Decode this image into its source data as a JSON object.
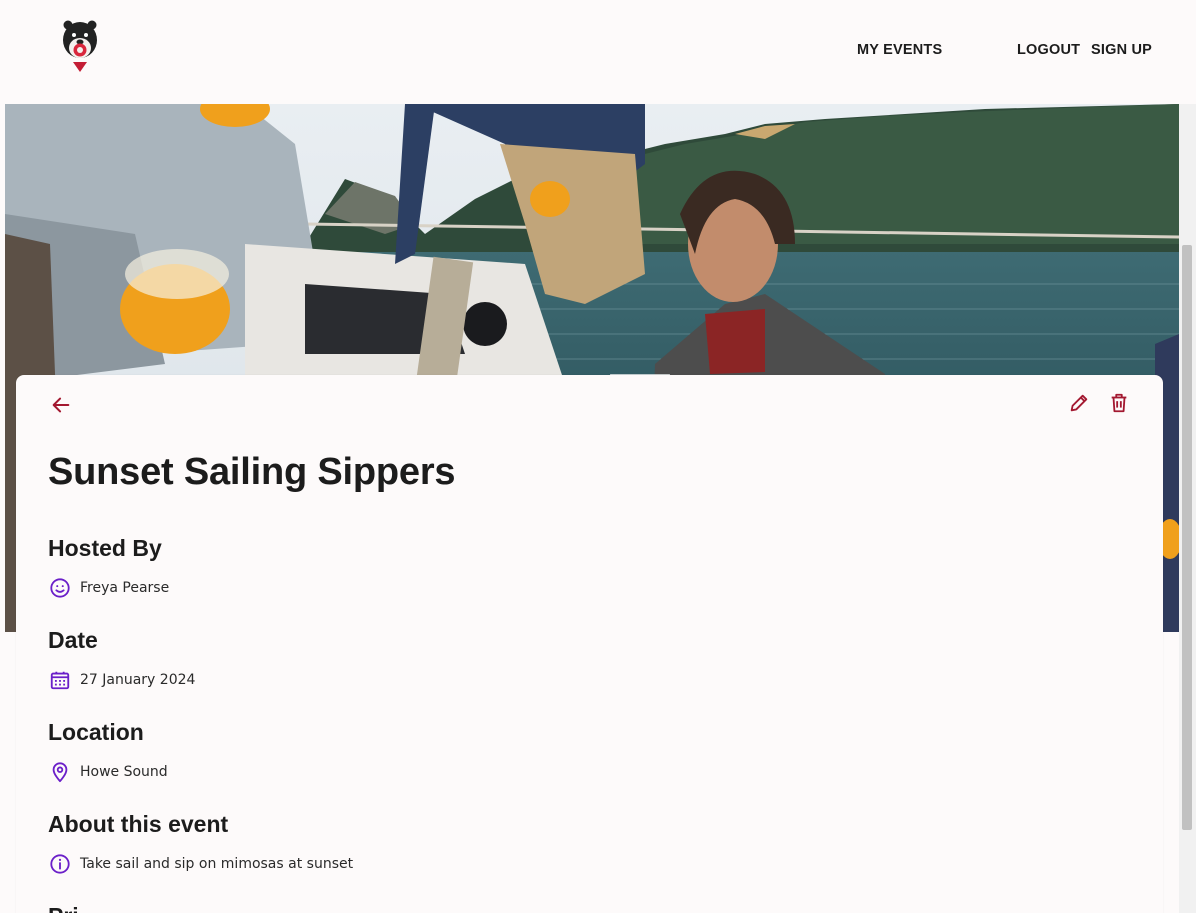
{
  "header": {
    "logo_icon": "bear-logo-icon",
    "nav": {
      "my_events": "MY EVENTS",
      "logout": "LOGOUT",
      "sign_up": "SIGN UP"
    }
  },
  "hero": {
    "icon": "event-cover-photo"
  },
  "event": {
    "title": "Sunset Sailing Sippers",
    "hosted_by": {
      "heading": "Hosted By",
      "value": "Freya Pearse",
      "icon": "smiley-face-icon"
    },
    "date": {
      "heading": "Date",
      "value": "27 January 2024",
      "icon": "calendar-icon"
    },
    "location": {
      "heading": "Location",
      "value": "Howe Sound",
      "icon": "location-pin-icon"
    },
    "about": {
      "heading": "About this event",
      "value": "Take sail and sip on mimosas at sunset",
      "icon": "info-icon"
    },
    "next_heading": "Pri"
  },
  "colors": {
    "accent_red": "#a31830",
    "icon_purple": "#6b1fc9",
    "background": "#fdfafa"
  }
}
